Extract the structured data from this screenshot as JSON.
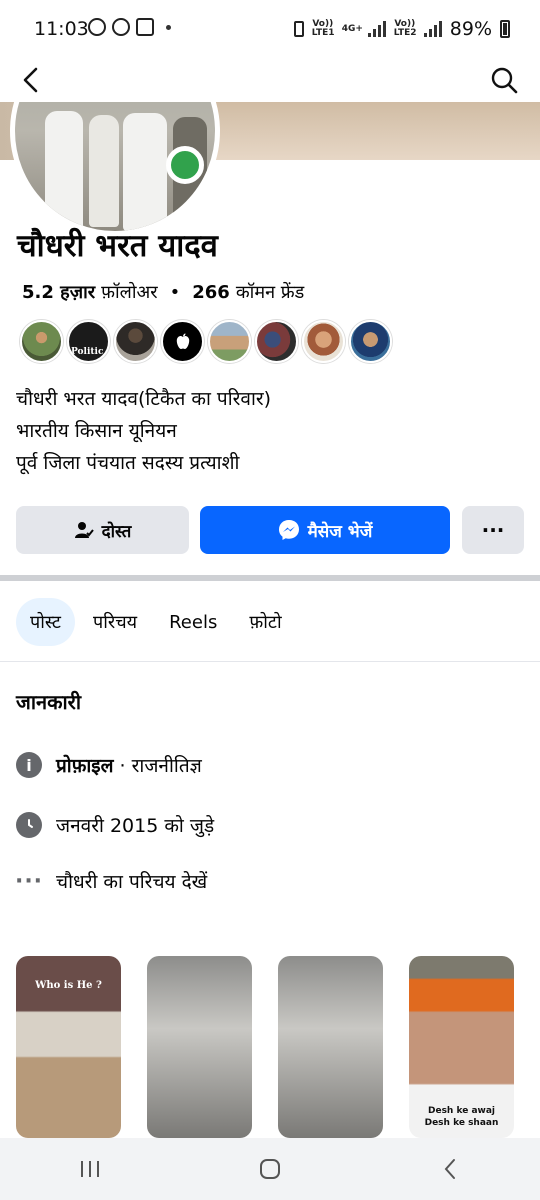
{
  "status": {
    "time": "11:03",
    "battery": "89%",
    "net1": "Vo)) LTE1",
    "net2": "Vo)) LTE2",
    "net_type": "4G+"
  },
  "profile": {
    "name": "चौधरी भरत यादव",
    "followers_count": "5.2 हज़ार",
    "followers_label": "फ़ॉलोअर",
    "mutual_count": "266",
    "mutual_label": "कॉमन फ्रेंड",
    "bio": [
      "चौधरी भरत यादव(टिकैत का परिवार)",
      "भारतीय किसान यूनियन",
      "पूर्व जिला पंचयात सदस्य प्रत्याशी"
    ],
    "online": true
  },
  "actions": {
    "friend_label": "दोस्त",
    "message_label": "मैसेज भेजें",
    "more_label": "···"
  },
  "tabs": [
    {
      "label": "पोस्ट",
      "active": true
    },
    {
      "label": "परिचय",
      "active": false
    },
    {
      "label": "Reels",
      "active": false
    },
    {
      "label": "फ़ोटो",
      "active": false
    }
  ],
  "info": {
    "title": "जानकारी",
    "profile_label": "प्रोफ़ाइल",
    "profile_sep": " · ",
    "profile_value": "राजनीतिज्ञ",
    "joined": "जनवरी 2015 को जुड़े",
    "see_intro": "चौधरी का परिचय देखें"
  },
  "reels": {
    "reel1_overlay": "Who is He ?",
    "reel4_caption1": "Desh ke awaj",
    "reel4_caption2": "Desh ke shaan"
  },
  "mutual_friend_thumb4_text": "",
  "mutual_friend_thumb2_text": "Politic",
  "colors": {
    "accent": "#0866ff",
    "online": "#31a24c",
    "button_gray": "#e4e6eb",
    "tab_active_bg": "#e7f3ff"
  }
}
